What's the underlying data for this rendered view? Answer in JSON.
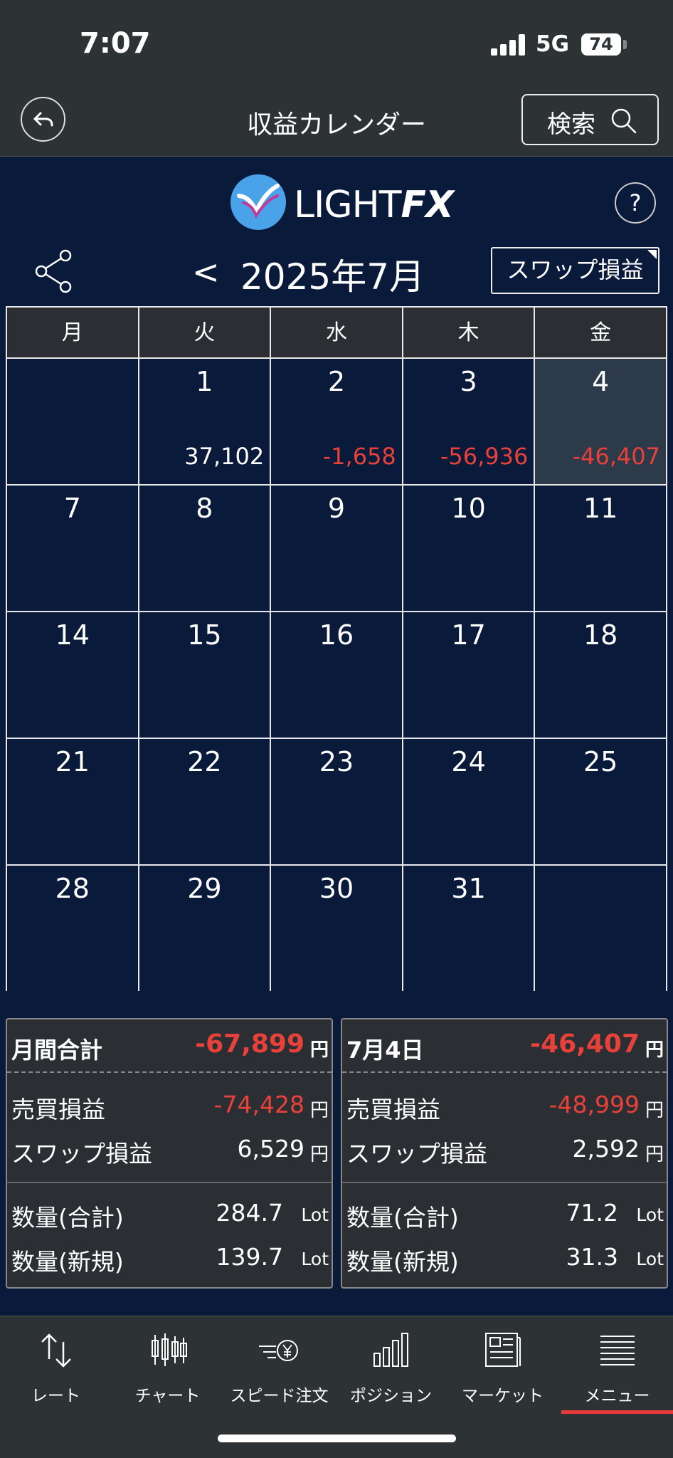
{
  "status": {
    "time": "7:07",
    "network": "5G",
    "battery": "74"
  },
  "nav": {
    "title": "収益カレンダー",
    "search_label": "検索"
  },
  "logo": {
    "text_light": "LIGHT",
    "text_fx": "FX"
  },
  "help": "?",
  "month": {
    "prev": "<",
    "label": "2025年7月",
    "swap_button": "スワップ損益"
  },
  "calendar": {
    "weekdays": [
      "月",
      "火",
      "水",
      "木",
      "金"
    ],
    "rows": [
      [
        {
          "day": "",
          "value": ""
        },
        {
          "day": "1",
          "value": "37,102"
        },
        {
          "day": "2",
          "value": "-1,658"
        },
        {
          "day": "3",
          "value": "-56,936"
        },
        {
          "day": "4",
          "value": "-46,407"
        }
      ],
      [
        {
          "day": "7",
          "value": ""
        },
        {
          "day": "8",
          "value": ""
        },
        {
          "day": "9",
          "value": ""
        },
        {
          "day": "10",
          "value": ""
        },
        {
          "day": "11",
          "value": ""
        }
      ],
      [
        {
          "day": "14",
          "value": ""
        },
        {
          "day": "15",
          "value": ""
        },
        {
          "day": "16",
          "value": ""
        },
        {
          "day": "17",
          "value": ""
        },
        {
          "day": "18",
          "value": ""
        }
      ],
      [
        {
          "day": "21",
          "value": ""
        },
        {
          "day": "22",
          "value": ""
        },
        {
          "day": "23",
          "value": ""
        },
        {
          "day": "24",
          "value": ""
        },
        {
          "day": "25",
          "value": ""
        }
      ],
      [
        {
          "day": "28",
          "value": ""
        },
        {
          "day": "29",
          "value": ""
        },
        {
          "day": "30",
          "value": ""
        },
        {
          "day": "31",
          "value": ""
        },
        {
          "day": "",
          "value": ""
        }
      ]
    ]
  },
  "summary_month": {
    "title": "月間合計",
    "total": "-67,899",
    "yen": "円",
    "trade_label": "売買損益",
    "trade": "-74,428",
    "swap_label": "スワップ損益",
    "swap": "6,529",
    "qty_total_label": "数量(合計)",
    "qty_total": "284.7",
    "qty_new_label": "数量(新規)",
    "qty_new": "139.7",
    "lot": "Lot"
  },
  "summary_day": {
    "title": "7月4日",
    "total": "-46,407",
    "yen": "円",
    "trade_label": "売買損益",
    "trade": "-48,999",
    "swap_label": "スワップ損益",
    "swap": "2,592",
    "qty_total_label": "数量(合計)",
    "qty_total": "71.2",
    "qty_new_label": "数量(新規)",
    "qty_new": "31.3",
    "lot": "Lot"
  },
  "tabs": [
    {
      "label": "レート",
      "icon": "rate-arrows-icon"
    },
    {
      "label": "チャート",
      "icon": "candlestick-icon"
    },
    {
      "label": "スピード注文",
      "icon": "speed-order-icon"
    },
    {
      "label": "ポジション",
      "icon": "bar-chart-icon"
    },
    {
      "label": "マーケット",
      "icon": "newspaper-icon"
    },
    {
      "label": "メニュー",
      "icon": "menu-icon"
    }
  ],
  "colors": {
    "background": "#0a1a3a",
    "panel": "#2b2f33",
    "negative": "#e8413a",
    "active_tab": "#e83b3b"
  }
}
